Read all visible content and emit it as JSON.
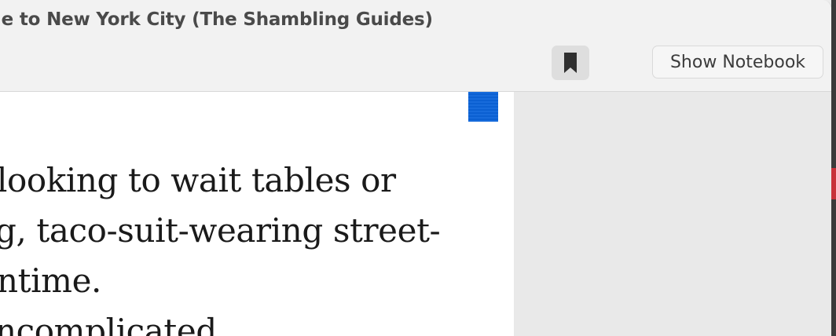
{
  "window": {
    "title": "le to New York City (The Shambling Guides)"
  },
  "toolbar": {
    "bookmark_icon": "bookmark-icon",
    "show_notebook_label": "Show Notebook"
  },
  "page": {
    "bookmark_ribbon_color": "#0b63d9",
    "lines": [
      "looking to wait tables or",
      "g, taco-suit-wearing street-",
      "ntime.",
      "ncomplicated"
    ]
  }
}
